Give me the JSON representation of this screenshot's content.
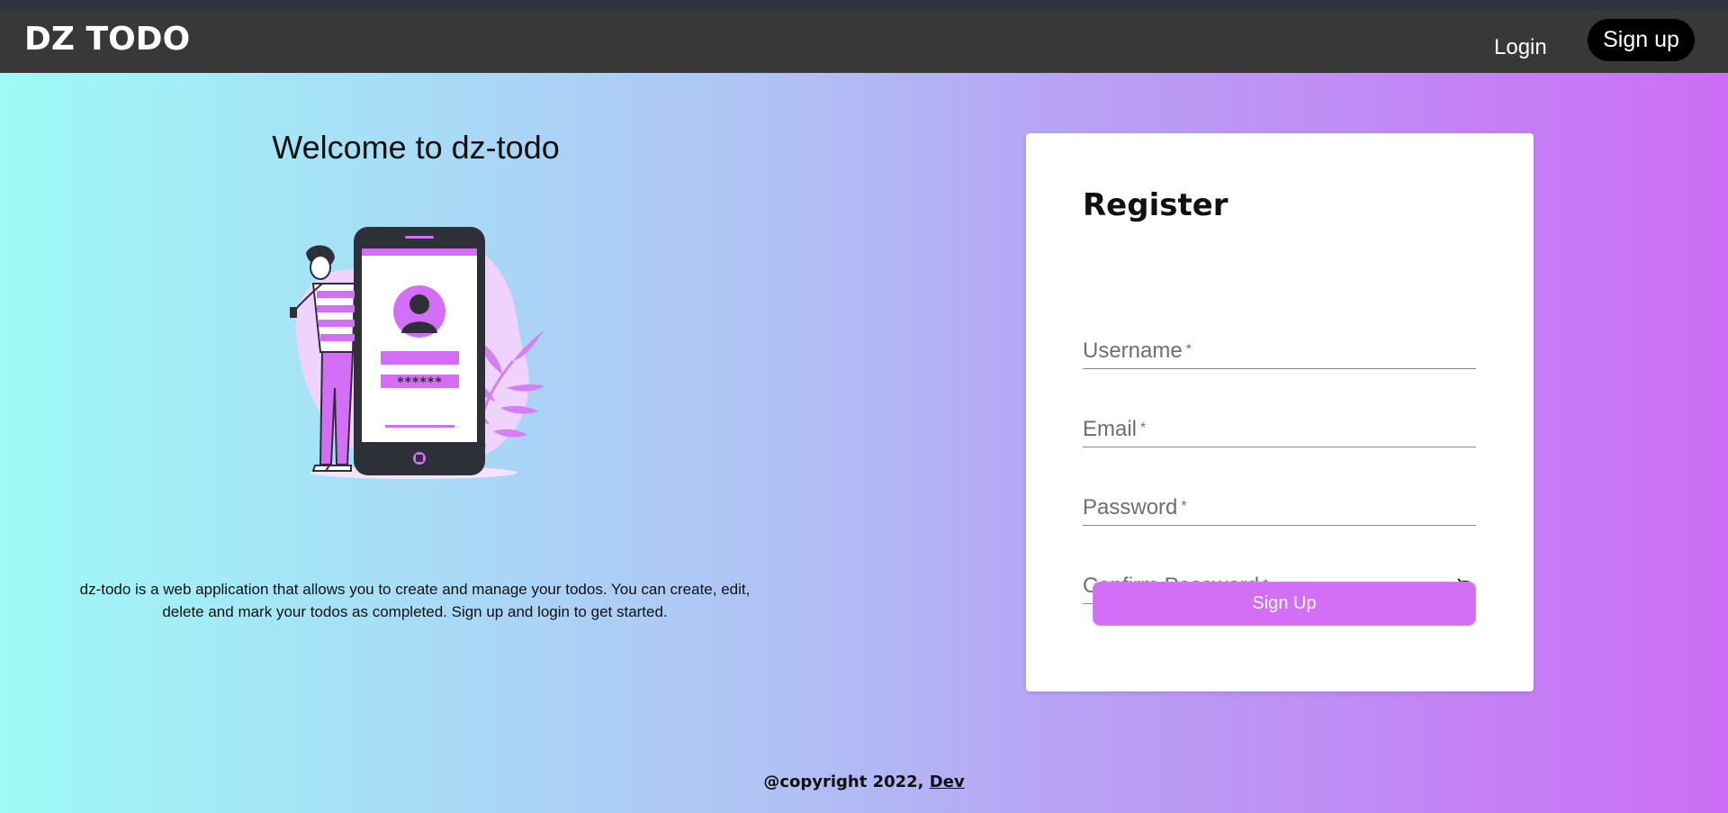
{
  "navbar": {
    "brand": "DZ TODO",
    "login_label": "Login",
    "signup_label": "Sign up"
  },
  "hero": {
    "title": "Welcome to dz-todo",
    "phone_password_mask": "******",
    "description": "dz-todo is a web application that allows you to create and manage your todos. You can create, edit, delete and mark your todos as completed. Sign up and login to get started."
  },
  "register": {
    "title": "Register",
    "fields": [
      {
        "label": "Username",
        "required": "*"
      },
      {
        "label": "Email",
        "required": "*"
      },
      {
        "label": "Password",
        "required": "*"
      },
      {
        "label": "Confirm Password",
        "required": "*"
      }
    ],
    "submit_label": "Sign Up"
  },
  "footer": {
    "copyright": "@copyright 2022, ",
    "link_label": "Dev"
  },
  "colors": {
    "navbar": "#383838",
    "accent": "#d36ef7",
    "gradient_start": "#9efaf6",
    "gradient_end": "#cc6df5"
  },
  "icons": {
    "password_toggle": "eye-off-icon"
  }
}
